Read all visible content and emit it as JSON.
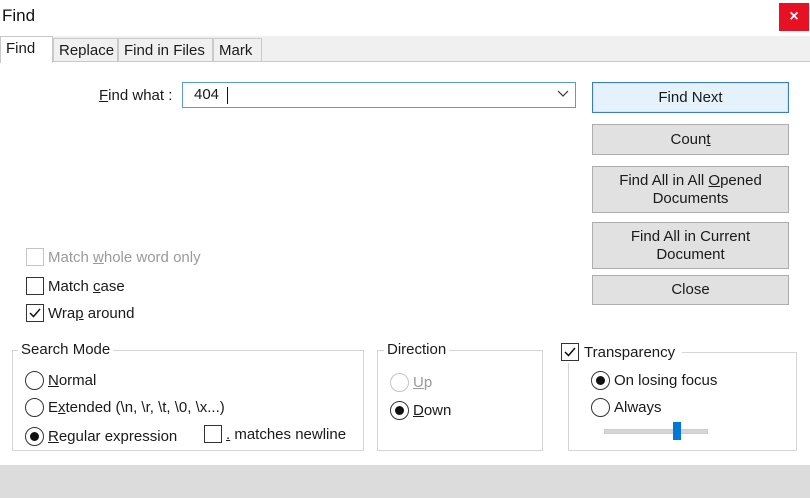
{
  "window": {
    "title": "Find",
    "close_label": "×"
  },
  "tabs": [
    {
      "label": "Find"
    },
    {
      "label": "Replace"
    },
    {
      "label": "Find in Files"
    },
    {
      "label": "Mark"
    }
  ],
  "find_what": {
    "label_pre": "",
    "label_hot": "F",
    "label_post": "ind what :",
    "value": "404"
  },
  "buttons": {
    "find_next": "Find Next",
    "count_pre": "Coun",
    "count_hot": "t",
    "find_all_opened_pre": "Find All in All ",
    "find_all_opened_hot": "O",
    "find_all_opened_post": "pened",
    "find_all_opened_line2": "Documents",
    "find_all_current_line1": "Find All in Current",
    "find_all_current_line2": "Document",
    "close": "Close"
  },
  "options": {
    "match_whole_pre": "Match ",
    "match_whole_hot": "w",
    "match_whole_post": "hole word only",
    "match_case_pre": "Match ",
    "match_case_hot": "c",
    "match_case_post": "ase",
    "wrap_pre": "Wra",
    "wrap_hot": "p",
    "wrap_post": " around"
  },
  "search_mode": {
    "title": "Search Mode",
    "normal_hot": "N",
    "normal_post": "ormal",
    "extended_pre": "E",
    "extended_hot": "x",
    "extended_post": "tended (\\n, \\r, \\t, \\0, \\x...)",
    "regex_hot": "R",
    "regex_post": "egular expression",
    "dot_hot": ".",
    "dot_post": " matches newline"
  },
  "direction": {
    "title": "Direction",
    "up_hot": "U",
    "up_post": "p",
    "down_hot": "D",
    "down_post": "own"
  },
  "transparency": {
    "title": "Transparency",
    "on_losing_focus": "On losing focus",
    "always": "Always",
    "level": 0.72
  }
}
